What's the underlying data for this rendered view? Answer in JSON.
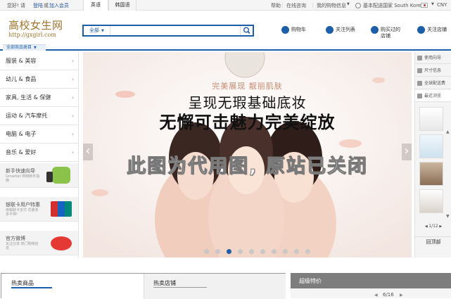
{
  "topbar": {
    "greeting": "您好! 请",
    "login": "登陆",
    "or": "或",
    "join": "加入会员",
    "tab_english": "英语",
    "tab_korean": "韩国语",
    "help": "帮助",
    "online_consult": "在线咨询",
    "my_shopping": "我的购物信息",
    "base_country": "基本配送国家 South Korea",
    "currency": "CNY"
  },
  "logo": {
    "title": "高校女生网",
    "url": "http://gxgirl.com"
  },
  "search": {
    "category": "全部",
    "placeholder": ""
  },
  "header_links": [
    {
      "label": "购物车",
      "icon": "cart-icon"
    },
    {
      "label": "关注列表",
      "icon": "heart-icon"
    },
    {
      "label": "购买过的店铺",
      "icon": "store-icon"
    },
    {
      "label": "关注店铺",
      "icon": "star-icon"
    }
  ],
  "category_button": "全部商品类目",
  "categories": [
    "服装 & 美容",
    "幼儿 & 食品",
    "家具, 生活 & 保健",
    "运动 & 汽车摩托",
    "电脑 & 电子",
    "音乐 & 爱好"
  ],
  "promos": [
    {
      "title": "新手快速向导",
      "sub": "Gmarket 购物新手指南"
    },
    {
      "title": "银联卡用户特惠",
      "sub": "用银联卡支付 优惠多多不停!"
    },
    {
      "title": "官方微博",
      "sub": "关注分享 热门购物信息"
    }
  ],
  "banner": {
    "line1": "完美展现   靓丽肌肤",
    "line2": "呈现无瑕基础底妆",
    "line3": "无懈可击魅力完美绽放",
    "watermark": "此图为代用图, 原站已关闭",
    "slide_count": 10,
    "active_slide": 3
  },
  "right_sidebar": {
    "items": [
      "使用向导",
      "尺寸信息",
      "全球配送费",
      "最近浏览"
    ],
    "pager": "1/12",
    "back_top": "回顶部"
  },
  "bottom": {
    "hot_products": "热卖商品",
    "hot_stores": "热卖店铺",
    "super_special": "超级特价",
    "page": "6/16"
  },
  "colors": {
    "brand_blue": "#1d5ea8",
    "logo_gold": "#a0742b"
  }
}
